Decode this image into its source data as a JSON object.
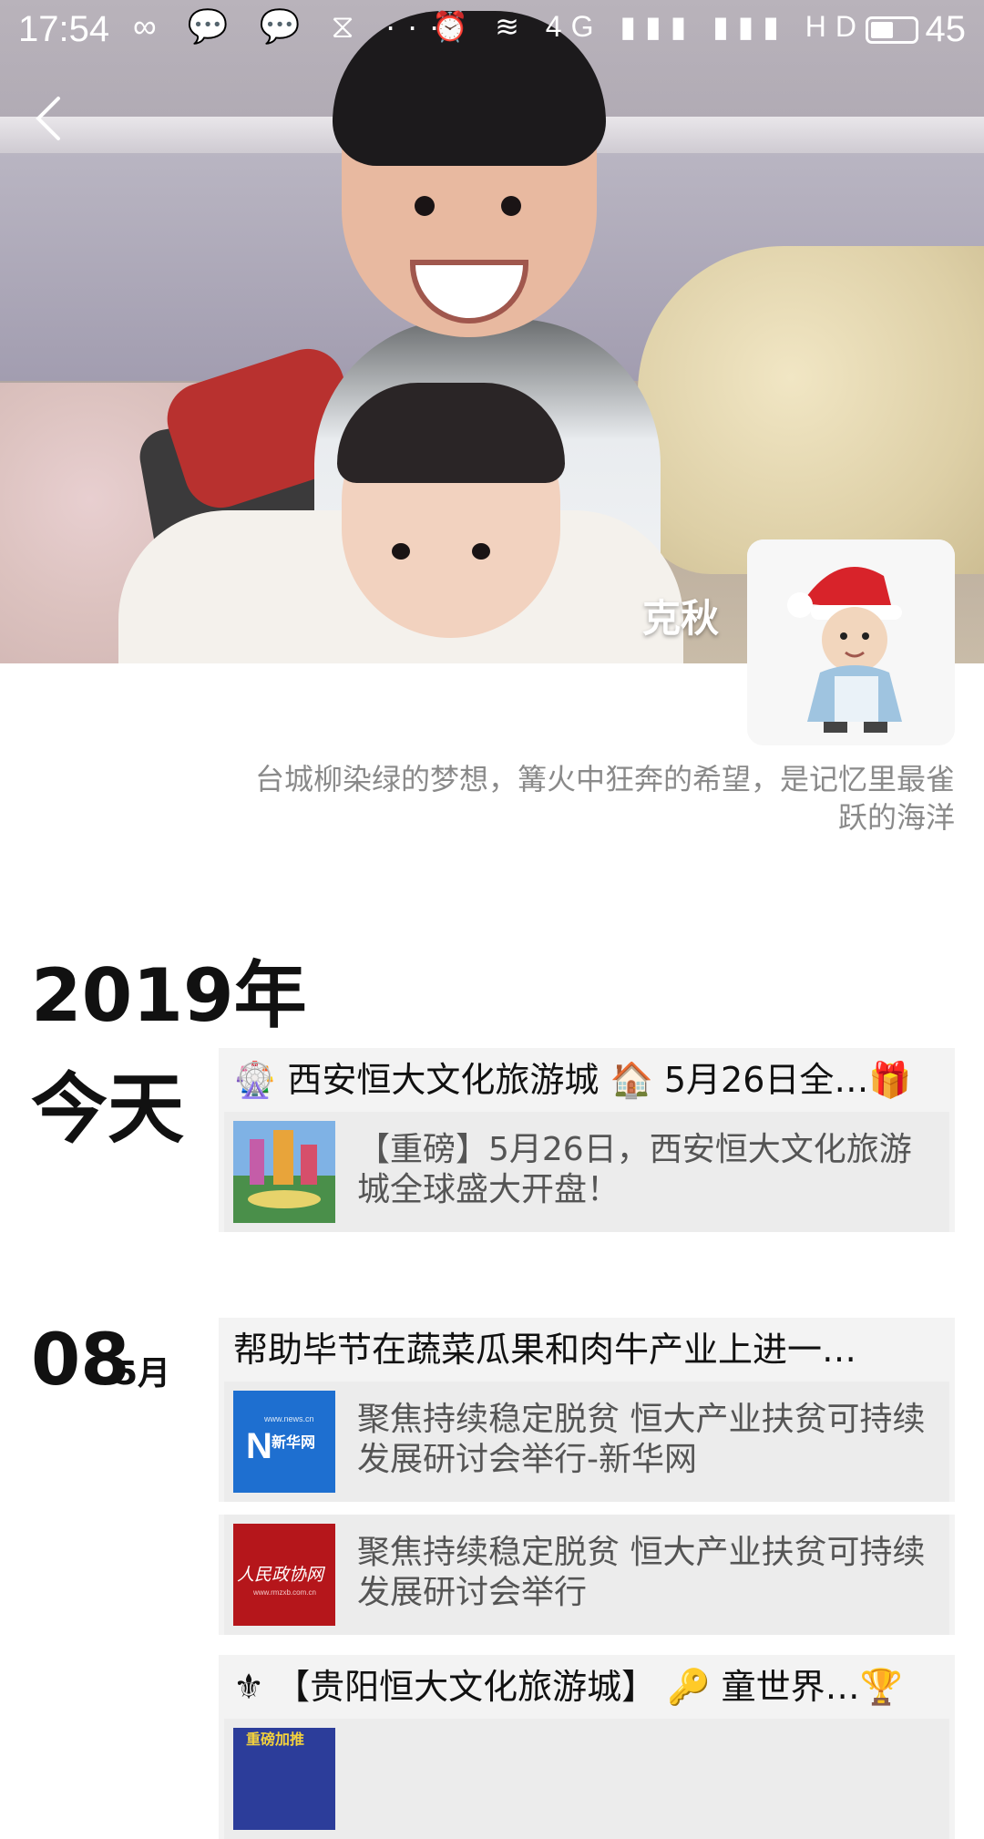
{
  "status_bar": {
    "time": "17:54",
    "left_icons": "∞ 💬 💬 ⧖ ···",
    "right_icons": "⏰ ≋ 4G ▮▮▮ ▮▮▮ HD",
    "battery": "45"
  },
  "profile": {
    "name": "克秋",
    "signature": "台城柳染绿的梦想，篝火中狂奔的希望，是记忆里最雀跃的海洋"
  },
  "timeline": {
    "year": "2019年",
    "entries": [
      {
        "date_label": "今天",
        "title": "🎡 西安恒大文化旅游城 🏠 5月26日全…🎁",
        "items": [
          {
            "text": "【重磅】5月26日，西安恒大文化旅游城全球盛大开盘！",
            "thumb_text": ""
          }
        ]
      },
      {
        "day": "08",
        "month": "5月",
        "title": "帮助毕节在蔬菜瓜果和肉牛产业上进一…",
        "items": [
          {
            "text": "聚焦持续稳定脱贫 恒大产业扶贫可持续发展研讨会举行-新华网",
            "thumb_text": "新华网",
            "thumb_sub": "www.news.cn"
          },
          {
            "text": "聚焦持续稳定脱贫 恒大产业扶贫可持续发展研讨会举行",
            "thumb_text": "人民政协网",
            "thumb_sub": "www.rmzxb.com.cn"
          }
        ]
      },
      {
        "title": "⚜ 【贵阳恒大文化旅游城】 🔑 童世界…🏆",
        "items": [
          {
            "text": "",
            "thumb_text": "重磅加推"
          }
        ]
      }
    ]
  },
  "colors": {
    "card_bg": "#f3f3f3",
    "row_bg": "#ececec",
    "xinhua_blue": "#1e6fd0",
    "rmzxb_red": "#b5161b"
  }
}
